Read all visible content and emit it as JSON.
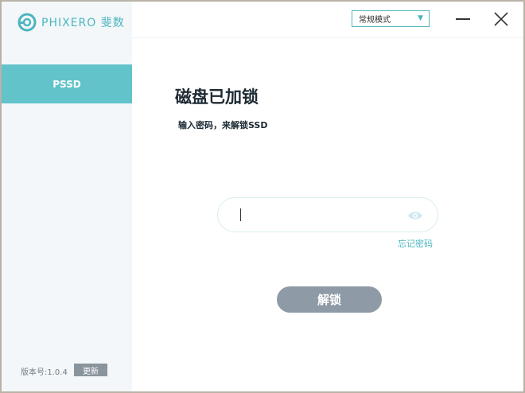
{
  "app": {
    "brand": "PHIXERO",
    "brand_cn": "斐数"
  },
  "sidebar": {
    "items": [
      {
        "label": "PSSD",
        "active": true
      }
    ],
    "version_label": "版本号:1.0.4",
    "update_label": "更新"
  },
  "header": {
    "mode_select": {
      "value": "常规模式"
    }
  },
  "main": {
    "title": "磁盘已加锁",
    "subtitle": "输入密码，来解锁SSD",
    "password": {
      "value": "",
      "placeholder": ""
    },
    "forgot_label": "忘记密码",
    "unlock_label": "解锁"
  },
  "colors": {
    "accent": "#4bb5bf",
    "active_nav": "#62c3ca",
    "button": "#8e9aa5"
  },
  "icons": [
    "logo-icon",
    "chevron-down-icon",
    "minimize-icon",
    "close-icon",
    "eye-icon"
  ]
}
